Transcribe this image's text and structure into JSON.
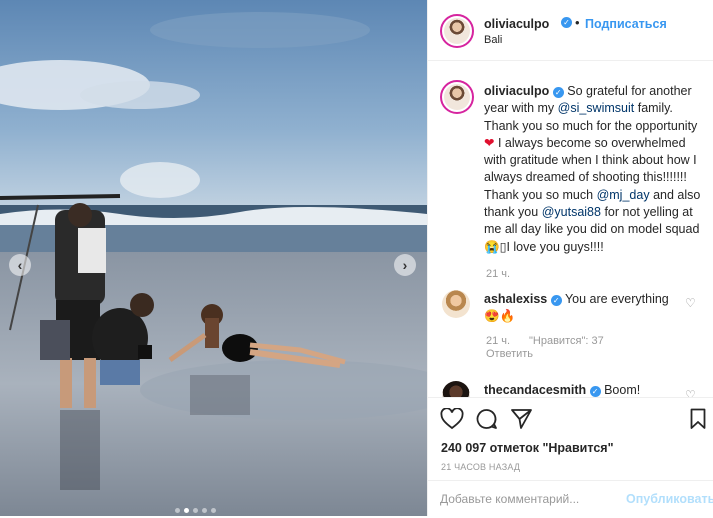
{
  "post": {
    "username": "oliviaculpo",
    "follow_label": "Подписаться",
    "dot": "•",
    "location": "Bali",
    "verified_glyph": "✓"
  },
  "caption": {
    "username": "oliviaculpo",
    "part1": "So grateful for another year with my",
    "mention1": "@si_swimsuit",
    "part2": "family. Thank you so much for the opportunity",
    "heart": "❤",
    "part3": "I always become so overwhelmed with gratitude when I think about how I always dreamed of shooting this!!!!!!! Thank you so much",
    "mention2": "@mj_day",
    "part4": "and also thank you",
    "mention3": "@yutsai88",
    "part5": "for not yelling at me all day like you did on model squad 😭▯I love you guys!!!!",
    "time": "21 ч."
  },
  "comments": [
    {
      "username": "ashalexiss",
      "text": "You are everything",
      "emoji": "😍🔥",
      "time": "21 ч.",
      "likes": "\"Нравится\": 37",
      "reply": "Ответить"
    },
    {
      "username": "thecandacesmith",
      "text": "Boom!"
    }
  ],
  "actions": {
    "likes_text": "240 097 отметок \"Нравится\"",
    "timestamp": "21 ЧАСОВ НАЗАД",
    "comment_placeholder": "Добавьте комментарий...",
    "publish_label": "Опубликовать"
  },
  "icons": {
    "nav_prev": "‹",
    "nav_next": "›",
    "like_small": "♡"
  },
  "colors": {
    "accent": "#3897f0",
    "mention": "#003569",
    "muted": "#999999"
  }
}
